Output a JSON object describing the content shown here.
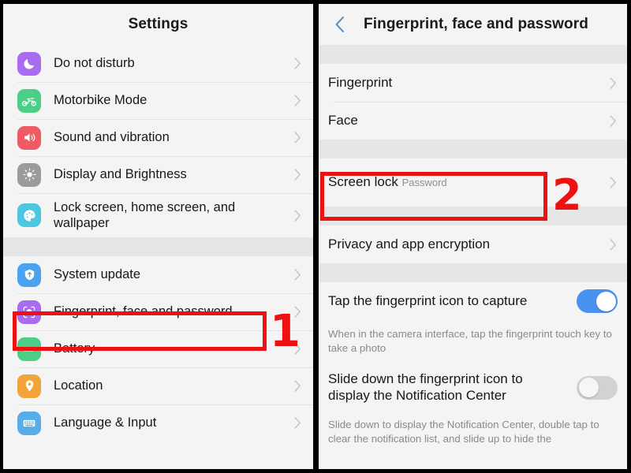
{
  "colors": {
    "accent_blue": "#4a92ef",
    "annotation_red": "#ee1111",
    "panel_bg": "#f4f4f4",
    "band_gray": "#e6e6e6",
    "back_chevron": "#5b87b5"
  },
  "left_panel": {
    "header": {
      "title": "Settings"
    },
    "groups": [
      {
        "items": [
          {
            "label": "Do not disturb",
            "icon": "moon-icon",
            "icon_color": "#a96cf0"
          },
          {
            "label": "Motorbike Mode",
            "icon": "motorbike-icon",
            "icon_color": "#4dce86"
          },
          {
            "label": "Sound and vibration",
            "icon": "speaker-icon",
            "icon_color": "#ef5b64"
          },
          {
            "label": "Display and Brightness",
            "icon": "brightness-icon",
            "icon_color": "#9b9b9b"
          },
          {
            "label": "Lock screen, home screen, and wallpaper",
            "icon": "palette-icon",
            "icon_color": "#4dc6e0"
          }
        ]
      },
      {
        "items": [
          {
            "label": "System update",
            "icon": "system-update-icon",
            "icon_color": "#4aa3ef"
          },
          {
            "label": "Fingerprint, face and password",
            "icon": "face-id-icon",
            "icon_color": "#a96cf0"
          },
          {
            "label": "Battery",
            "icon": "battery-icon",
            "icon_color": "#4dce86"
          },
          {
            "label": "Location",
            "icon": "location-pin-icon",
            "icon_color": "#f2a33c"
          },
          {
            "label": "Language & Input",
            "icon": "keyboard-icon",
            "icon_color": "#56ade8"
          }
        ]
      }
    ]
  },
  "right_panel": {
    "header": {
      "title": "Fingerprint, face and password",
      "back_icon": "chevron-left-icon"
    },
    "groups": [
      {
        "items": [
          {
            "label": "Fingerprint",
            "type": "link"
          },
          {
            "label": "Face",
            "type": "link"
          }
        ]
      },
      {
        "items": [
          {
            "label": "Screen lock",
            "sub": "Password",
            "type": "link"
          }
        ]
      },
      {
        "items": [
          {
            "label": "Privacy and app encryption",
            "type": "link"
          }
        ]
      },
      {
        "items": [
          {
            "label": "Tap the fingerprint icon to capture",
            "type": "toggle",
            "state": "on",
            "desc": "When in the camera interface, tap the fingerprint touch key to take a photo"
          },
          {
            "label": "Slide down the fingerprint icon to display the Notification Center",
            "type": "toggle",
            "state": "off",
            "desc": "Slide down to display the Notification Center, double tap to clear the notification list, and slide up to hide the"
          }
        ]
      }
    ]
  },
  "annotations": [
    {
      "number": "1",
      "target": "Fingerprint, face and password"
    },
    {
      "number": "2",
      "target": "Screen lock"
    }
  ]
}
